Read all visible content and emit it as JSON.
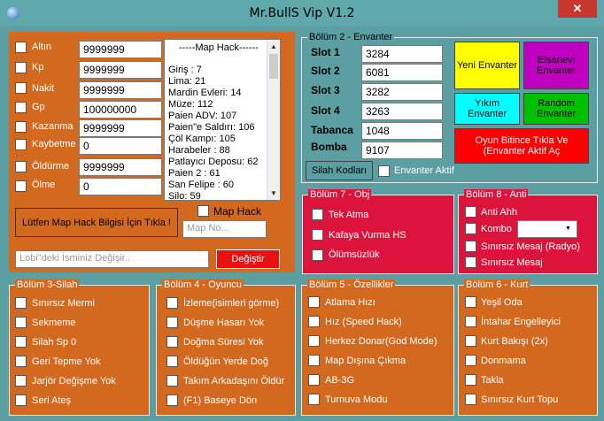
{
  "window": {
    "title": "Mr.BullS Vip V1.2",
    "close_symbol": "✕"
  },
  "stats": {
    "rows": [
      {
        "label": "Altın",
        "value": "9999999"
      },
      {
        "label": "Kp",
        "value": "9999999"
      },
      {
        "label": "Nakit",
        "value": "9999999"
      },
      {
        "label": "Gp",
        "value": "100000000"
      },
      {
        "label": "Kazanma",
        "value": "9999999"
      },
      {
        "label": "Kaybetme",
        "value": "0"
      },
      {
        "label": "Öldürme",
        "value": "9999999"
      },
      {
        "label": "Ölme",
        "value": "0"
      }
    ]
  },
  "map_hack": {
    "header": "-----Map Hack------",
    "items": [
      "Giriş : 7",
      "Lima: 21",
      "Mardin Evleri: 14",
      "Müze: 112",
      "Paien ADV: 107",
      "Paien\"e Saldırı: 106",
      "Çöl Kampı: 105",
      "Harabeler : 88",
      "Patlayıcı Deposu: 62",
      "Paien 2 : 61",
      "San Felipe : 60",
      "Silo: 59"
    ],
    "info_button": "Lütfen Map Hack Bilgisi İçin Tıkla !",
    "checkbox_label": "Map Hack",
    "map_no_placeholder": "Map No..."
  },
  "name_change": {
    "placeholder": "Lobi\"deki İsminiz Değişir..",
    "button": "Değiştir"
  },
  "inventory": {
    "legend": "Bölüm 2 - Envanter",
    "slots": [
      {
        "label": "Slot 1",
        "value": "3284"
      },
      {
        "label": "Slot 2",
        "value": "6081"
      },
      {
        "label": "Slot 3",
        "value": "3282"
      },
      {
        "label": "Slot 4",
        "value": "3263"
      },
      {
        "label": "Tabanca",
        "value": "1048"
      },
      {
        "label": "Bomba",
        "value": "9107"
      }
    ],
    "buttons": {
      "new": "Yeni Envanter",
      "legendary": "Efsanevi Envanter",
      "wreck": "Yıkım Envanter",
      "random": "Random Envanter",
      "after_game": "Oyun Bitince Tıkla Ve (Envanter Aktif Aç"
    },
    "weapons_button": "Silah Kodları",
    "active_label": "Envanter Aktif"
  },
  "obj": {
    "legend": "Bölüm 7 - Obj",
    "items": [
      "Tek Atma",
      "Kafaya Vurma HS",
      "Ölümsüzlük"
    ]
  },
  "anti": {
    "legend": "Bölüm 8 - Anti",
    "items": [
      "Anti Ahh",
      "Kombo",
      "Sınırsız Mesaj (Radyo)",
      "Sınırsız Mesaj"
    ],
    "combo_value": ""
  },
  "weapon": {
    "legend": "Bölüm 3-Silah",
    "items": [
      "Sınırsız Mermi",
      "Sekmeme",
      "Silah Sp 0",
      "Geri Tepme Yok",
      "Jarjör Değişme Yok",
      "Seri Ateş"
    ]
  },
  "player": {
    "legend": "Bölüm 4 - Oyuncu",
    "items": [
      "İzleme(isimleri görme)",
      "Düşme Hasarı Yok",
      "Doğma Süresi Yok",
      "Öldüğün Yerde Doğ",
      "Takım Arkadaşını Öldür",
      "(F1) Baseye Dön"
    ]
  },
  "features": {
    "legend": "Bölüm 5 - Özellikler",
    "items": [
      "Atlama Hızı",
      "Hız (Speed Hack)",
      "Herkez Donar(God Mode)",
      "Map Dışına Çıkma",
      "AB-3G",
      "Turnuva Modu"
    ]
  },
  "kurt": {
    "legend": "Bölüm 6 - Kurt",
    "items": [
      "Yeşil Oda",
      "İntahar Engelleyici",
      "Kurt Bakışı (2x)",
      "Donmama",
      "Takla",
      "Sınırsız Kurt Topu"
    ]
  },
  "colors": {
    "orange": "#d2691e",
    "teal": "#5b9fa3",
    "crimson": "#dc143c",
    "yellow": "#ffff00",
    "magenta": "#c000c0",
    "cyan": "#00ffff",
    "green": "#00c000",
    "red": "#ff0000"
  }
}
